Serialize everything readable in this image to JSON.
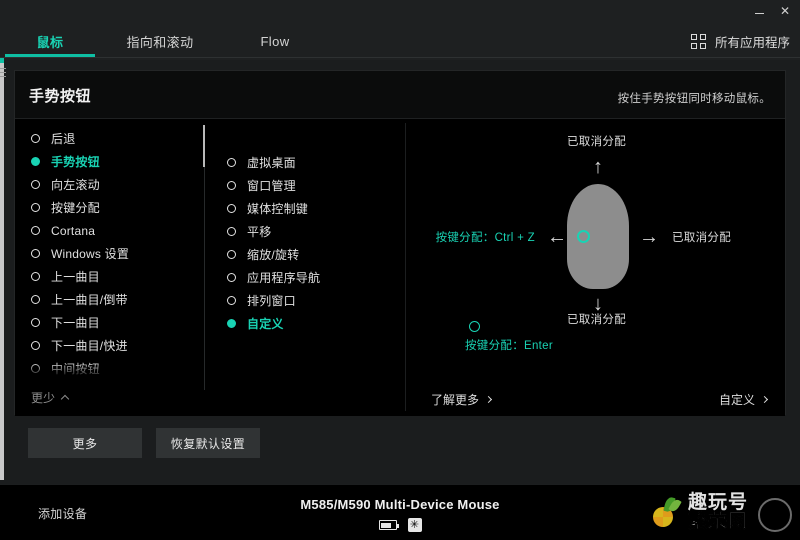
{
  "window": {
    "minimize_label": "–",
    "close_label": "✕"
  },
  "tabs": [
    {
      "label": "鼠标",
      "active": true
    },
    {
      "label": "指向和滚动",
      "active": false
    },
    {
      "label": "Flow",
      "active": false
    }
  ],
  "header": {
    "all_apps_label": "所有应用程序",
    "all_apps_icon": "grid-icon"
  },
  "card": {
    "title": "手势按钮",
    "subtitle": "按住手势按钮同时移动鼠标。"
  },
  "actions": {
    "items": [
      {
        "label": "后退",
        "selected": false
      },
      {
        "label": "手势按钮",
        "selected": true
      },
      {
        "label": "向左滚动",
        "selected": false
      },
      {
        "label": "按键分配",
        "selected": false
      },
      {
        "label": "Cortana",
        "selected": false
      },
      {
        "label": "Windows 设置",
        "selected": false
      },
      {
        "label": "上一曲目",
        "selected": false
      },
      {
        "label": "上一曲目/倒带",
        "selected": false
      },
      {
        "label": "下一曲目",
        "selected": false
      },
      {
        "label": "下一曲目/快进",
        "selected": false
      },
      {
        "label": "中间按钮",
        "selected": false
      }
    ],
    "less_label": "更少",
    "less_icon": "chevron-up-icon"
  },
  "suboptions": {
    "items": [
      {
        "label": "虚拟桌面",
        "selected": false
      },
      {
        "label": "窗口管理",
        "selected": false
      },
      {
        "label": "媒体控制键",
        "selected": false
      },
      {
        "label": "平移",
        "selected": false
      },
      {
        "label": "缩放/旋转",
        "selected": false
      },
      {
        "label": "应用程序导航",
        "selected": false
      },
      {
        "label": "排列窗口",
        "selected": false
      },
      {
        "label": "自定义",
        "selected": true
      }
    ]
  },
  "diagram": {
    "top_label": "已取消分配",
    "bottom_label": "已取消分配",
    "right_label": "已取消分配",
    "left_label": "按键分配：Ctrl + Z",
    "button_label": "按键分配：Enter",
    "arrow_up": "↑",
    "arrow_down": "↓",
    "arrow_left": "←",
    "arrow_right": "→",
    "learn_more_label": "了解更多",
    "customize_label": "自定义"
  },
  "footer_buttons": {
    "more_label": "更多",
    "restore_label": "恢复默认设置"
  },
  "bottom_bar": {
    "add_device_label": "添加设备",
    "device_name": "M585/M590 Multi-Device Mouse",
    "battery_icon": "battery-icon",
    "bluetooth_icon": "bluetooth-icon",
    "bluetooth_glyph": "✳"
  },
  "watermark": {
    "line1": "趣玩号",
    "line2": "繁荣网"
  },
  "colors": {
    "accent": "#19d3b4",
    "accent_dark": "#0fbfa4",
    "panel": "#0b0c0c",
    "chrome": "#1e2021",
    "button": "#303334",
    "mouse_body": "#8d8d8d"
  }
}
